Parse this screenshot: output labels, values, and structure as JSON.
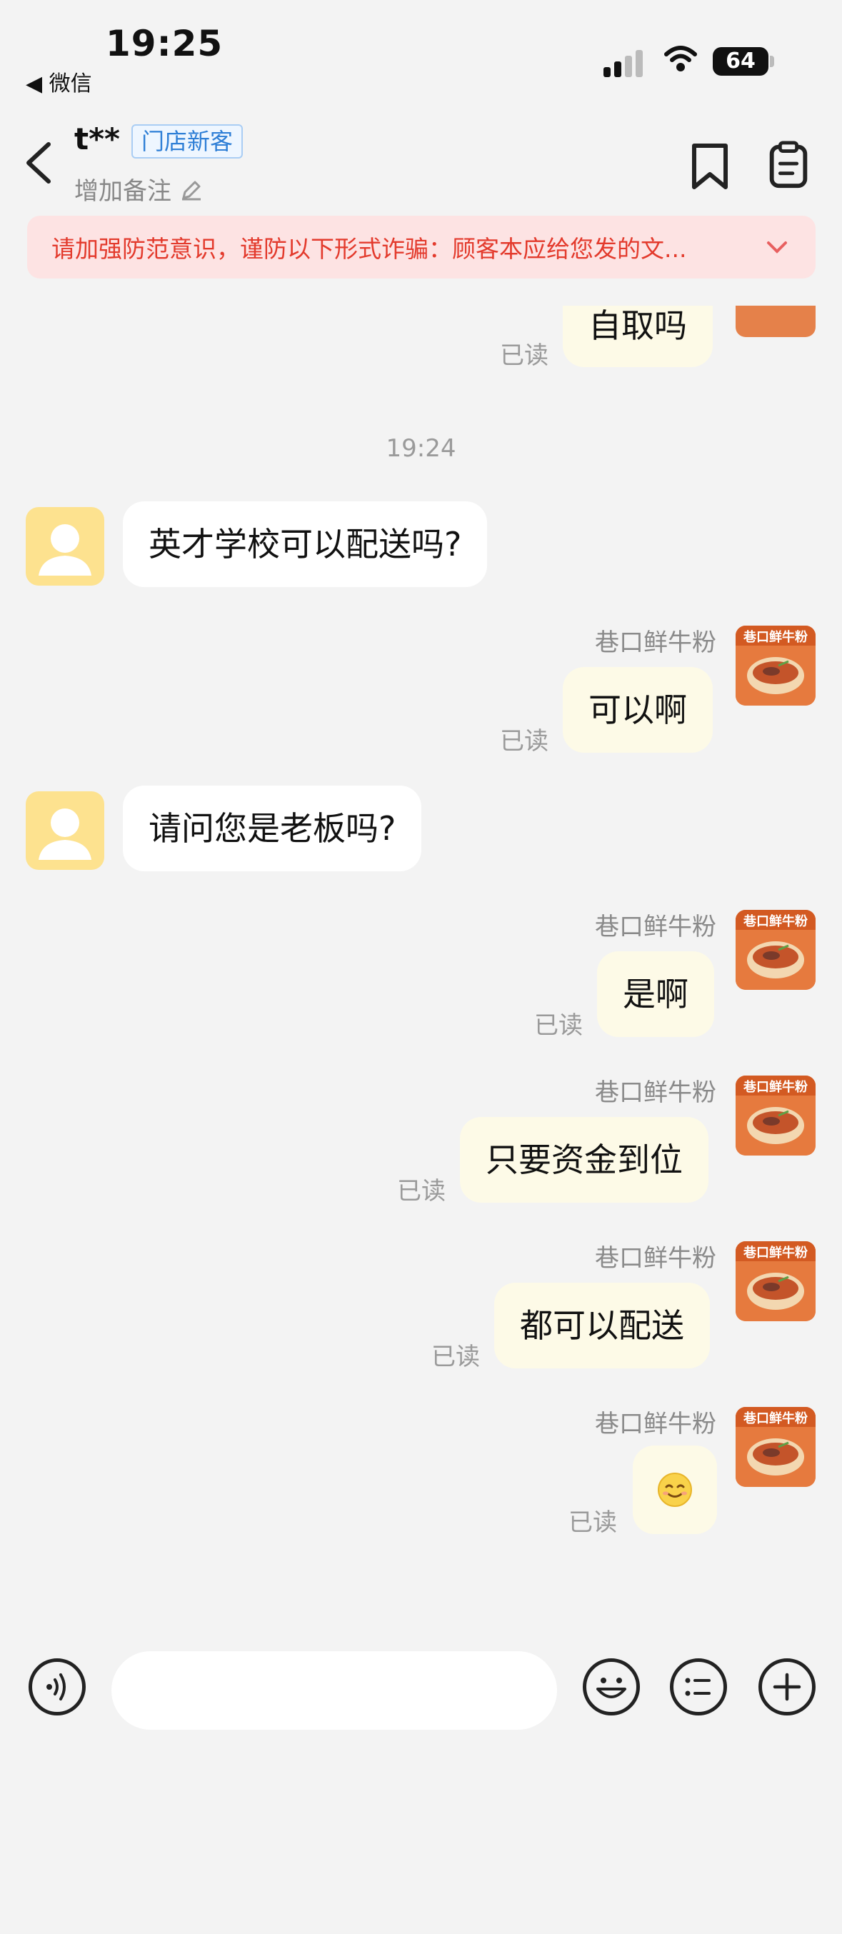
{
  "status_bar": {
    "time": "19:25",
    "back_app": "◀ 微信",
    "battery": "64"
  },
  "header": {
    "name": "t**",
    "tag": "门店新客",
    "add_note": "增加备注"
  },
  "warning": {
    "text": "请加强防范意识，谨防以下形式诈骗：顾客本应给您发的文..."
  },
  "chat": {
    "top_partial": {
      "text": "自取吗",
      "read": "已读"
    },
    "timestamp": "19:24",
    "messages": [
      {
        "side": "in",
        "text": "英才学校可以配送吗?"
      },
      {
        "side": "out",
        "sender": "巷口鲜牛粉",
        "text": "可以啊",
        "read": "已读"
      },
      {
        "side": "in",
        "text": "请问您是老板吗?"
      },
      {
        "side": "out",
        "sender": "巷口鲜牛粉",
        "text": "是啊",
        "read": "已读"
      },
      {
        "side": "out",
        "sender": "巷口鲜牛粉",
        "text": "只要资金到位",
        "read": "已读"
      },
      {
        "side": "out",
        "sender": "巷口鲜牛粉",
        "text": "都可以配送",
        "read": "已读"
      },
      {
        "side": "out",
        "sender": "巷口鲜牛粉",
        "text": "",
        "emoji": "smiling-face-emoji",
        "read": "已读"
      }
    ]
  },
  "shop_avatar": {
    "banner": "巷口鲜牛粉"
  },
  "input": {
    "placeholder": ""
  },
  "colors": {
    "warning_text": "#e33a2c",
    "outgoing_bubble": "#fdfae7",
    "tag_blue": "#2f7fd6"
  }
}
